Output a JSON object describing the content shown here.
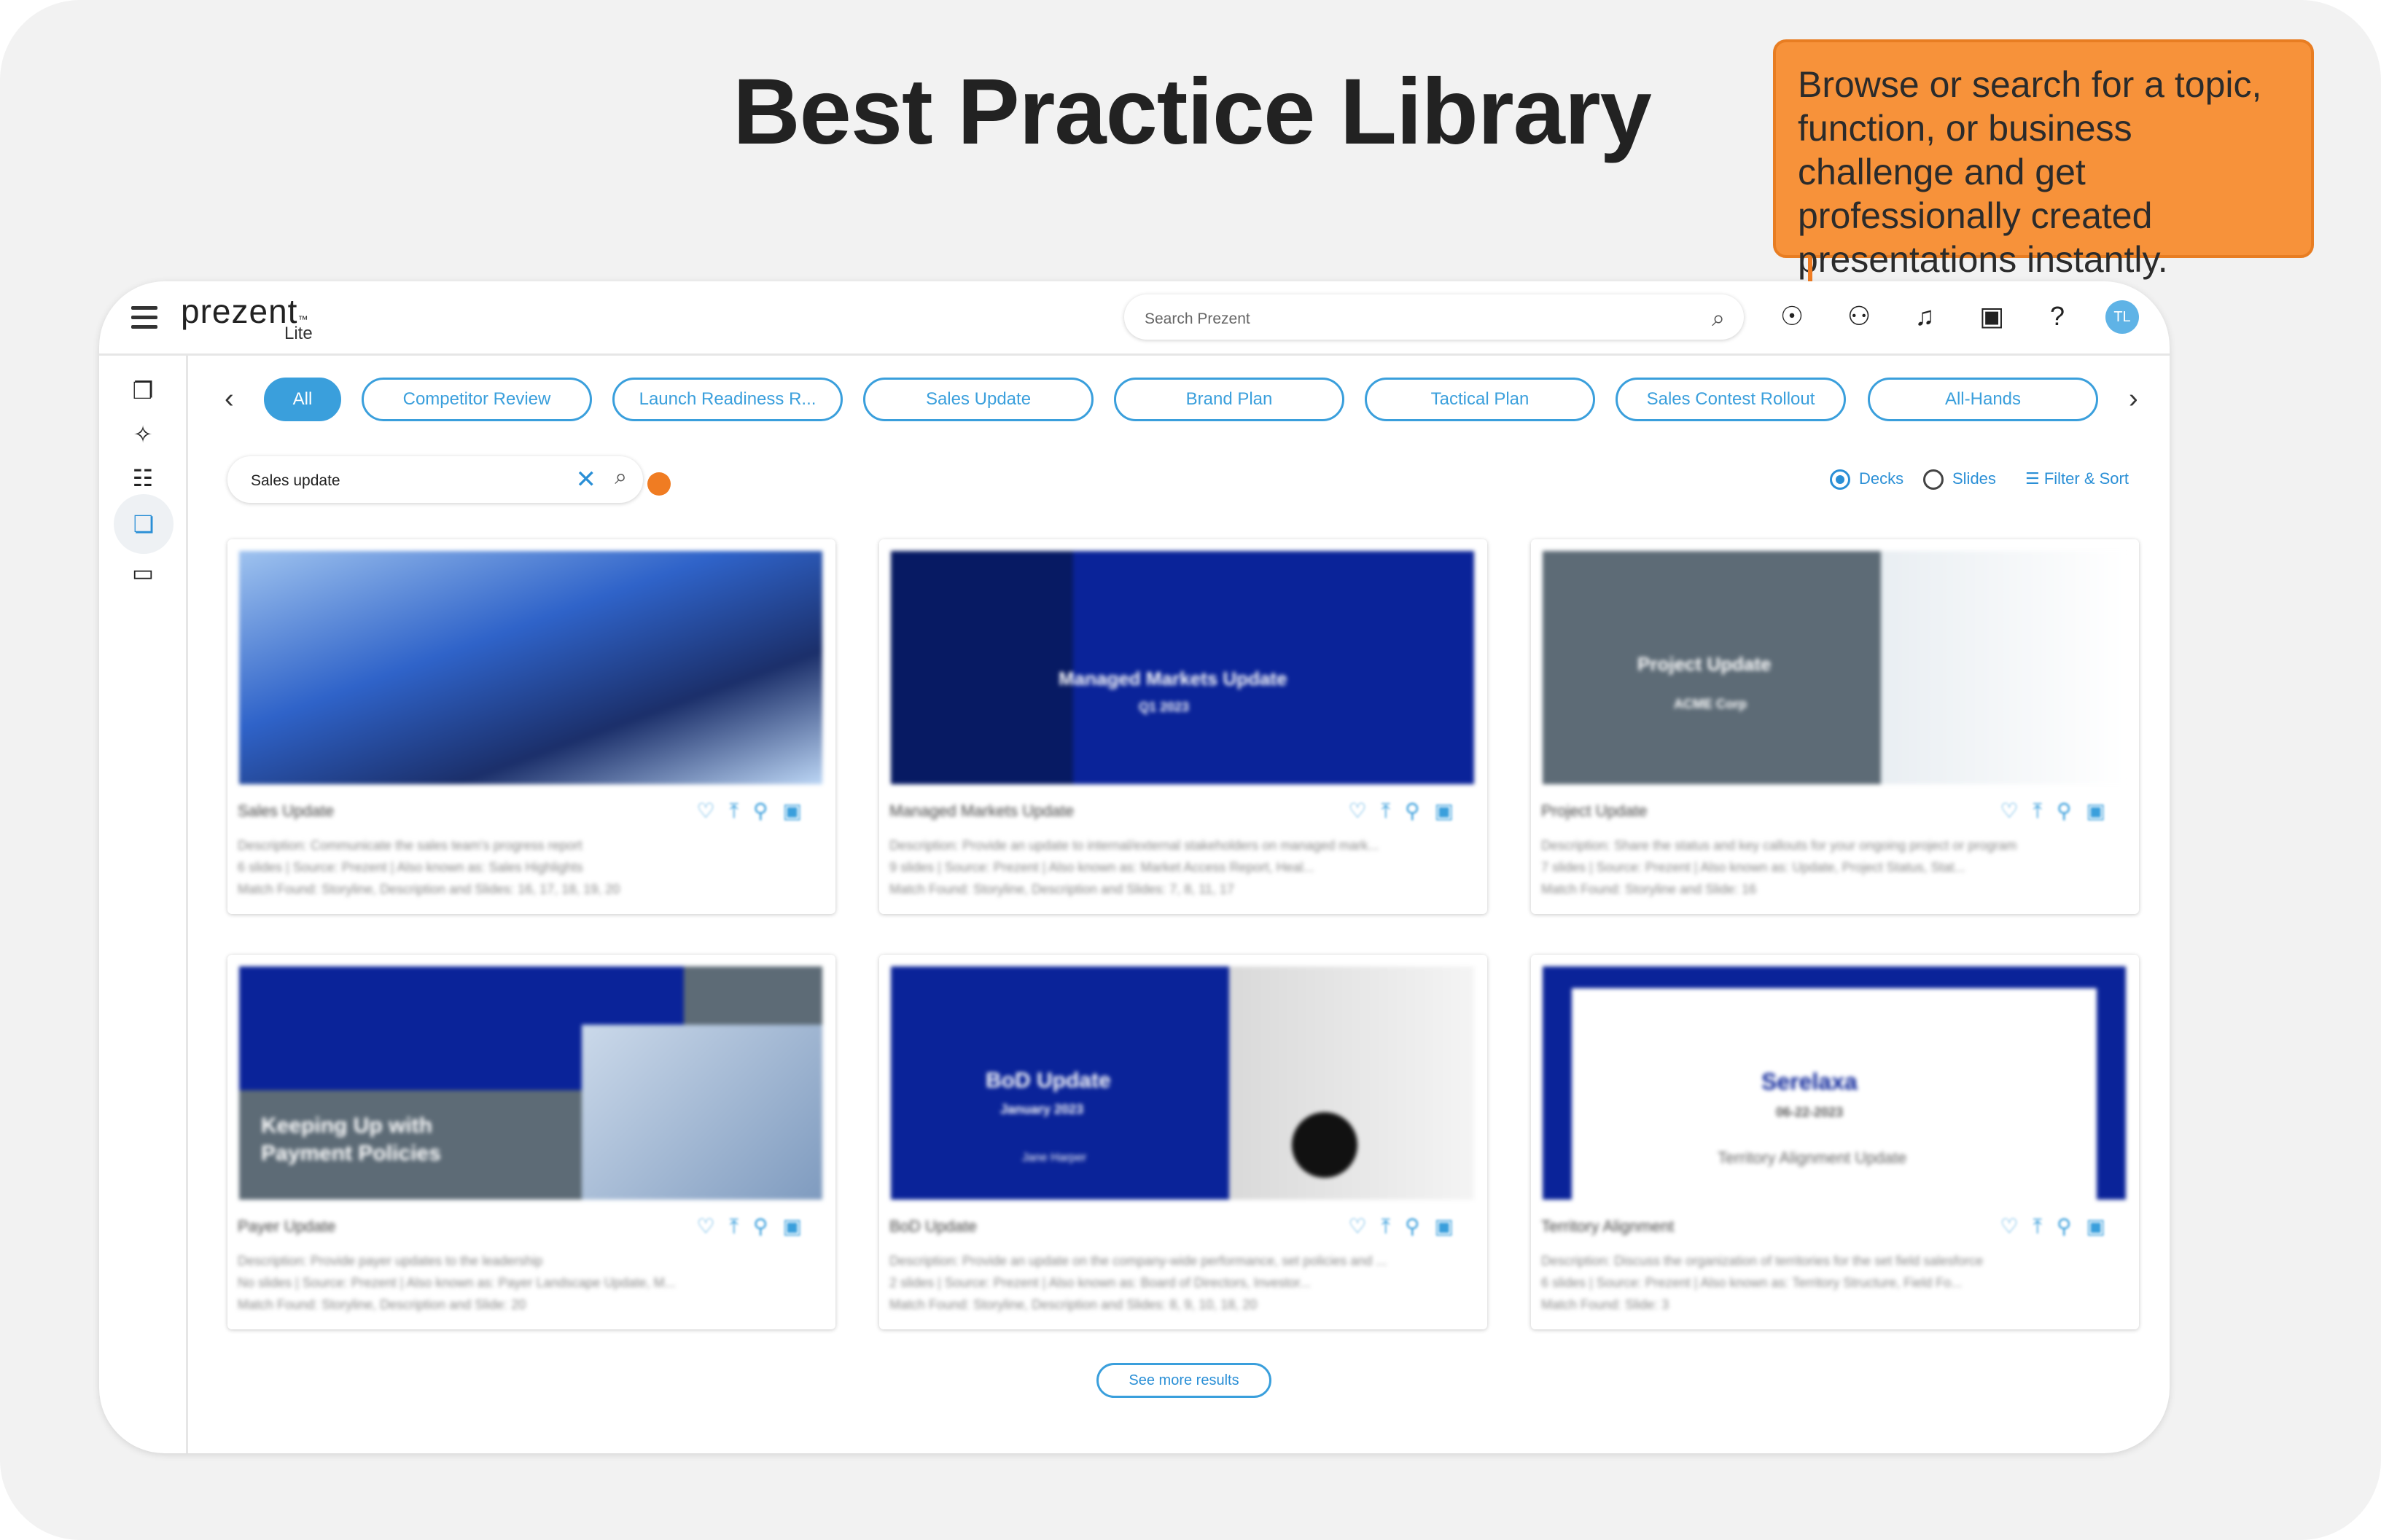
{
  "heading": "Best Practice Library",
  "callout": "Browse or search for a topic, function, or business challenge and get professionally created presentations instantly.",
  "app": {
    "logo": "prezent",
    "logo_tm": "™",
    "logo_sub": "Lite",
    "search_placeholder": "Search Prezent",
    "avatar": "TL"
  },
  "chips": [
    "All",
    "Competitor Review",
    "Launch Readiness R...",
    "Sales Update",
    "Brand Plan",
    "Tactical Plan",
    "Sales Contest Rollout",
    "All-Hands"
  ],
  "library_search": {
    "value": "Sales update"
  },
  "view": {
    "decks": "Decks",
    "slides": "Slides",
    "filter": "Filter & Sort"
  },
  "cards": [
    {
      "title": "Sales Update",
      "desc1": "Description: Communicate the sales team's progress report",
      "desc2": "6 slides | Source: Prezent | Also known as: Sales Highlights",
      "desc3": "Match Found: Storyline, Description and Slides: 16, 17, 18, 19, 20"
    },
    {
      "title": "Managed Markets Update",
      "thumb_title": "Managed Markets Update",
      "thumb_sub": "Q1 2023",
      "desc1": "Description: Provide an update to internal/external stakeholders on managed mark...",
      "desc2": "9 slides | Source: Prezent | Also known as: Market Access Report, Heal...",
      "desc3": "Match Found: Storyline, Description and Slides: 7, 8, 11, 17"
    },
    {
      "title": "Project Update",
      "thumb_title": "Project Update",
      "thumb_sub": "ACME Corp",
      "desc1": "Description: Share the status and key callouts for your ongoing project or program",
      "desc2": "7 slides | Source: Prezent | Also known as: Update, Project Status, Stat...",
      "desc3": "Match Found: Storyline and Slide: 16"
    },
    {
      "title": "Payer Update",
      "thumb_title": "Keeping Up with Payment Policies",
      "desc1": "Description: Provide payer updates to the leadership",
      "desc2": "No slides | Source: Prezent | Also known as: Payer Landscape Update, M...",
      "desc3": "Match Found: Storyline, Description and Slide: 20"
    },
    {
      "title": "BoD Update",
      "thumb_title": "BoD Update",
      "thumb_sub": "January 2023",
      "thumb_sub2": "Jane Harper",
      "desc1": "Description: Provide an update on the company-wide performance, set policies and ...",
      "desc2": "2 slides | Source: Prezent | Also known as: Board of Directors, Investor...",
      "desc3": "Match Found: Storyline, Description and Slides: 8, 9, 10, 18, 20"
    },
    {
      "title": "Territory Alignment",
      "thumb_title": "Serelaxa",
      "thumb_sub": "06-22-2023",
      "thumb_sub2": "Territory Alignment Update",
      "desc1": "Description: Discuss the organization of territories for the set field salesforce",
      "desc2": "6 slides | Source: Prezent | Also known as: Territory Structure, Field Fo...",
      "desc3": "Match Found: Slide: 3"
    }
  ],
  "see_more": "See more results",
  "colors": {
    "accent": "#3a9fdc",
    "callout": "#f7923a",
    "navy": "#0a2399"
  }
}
